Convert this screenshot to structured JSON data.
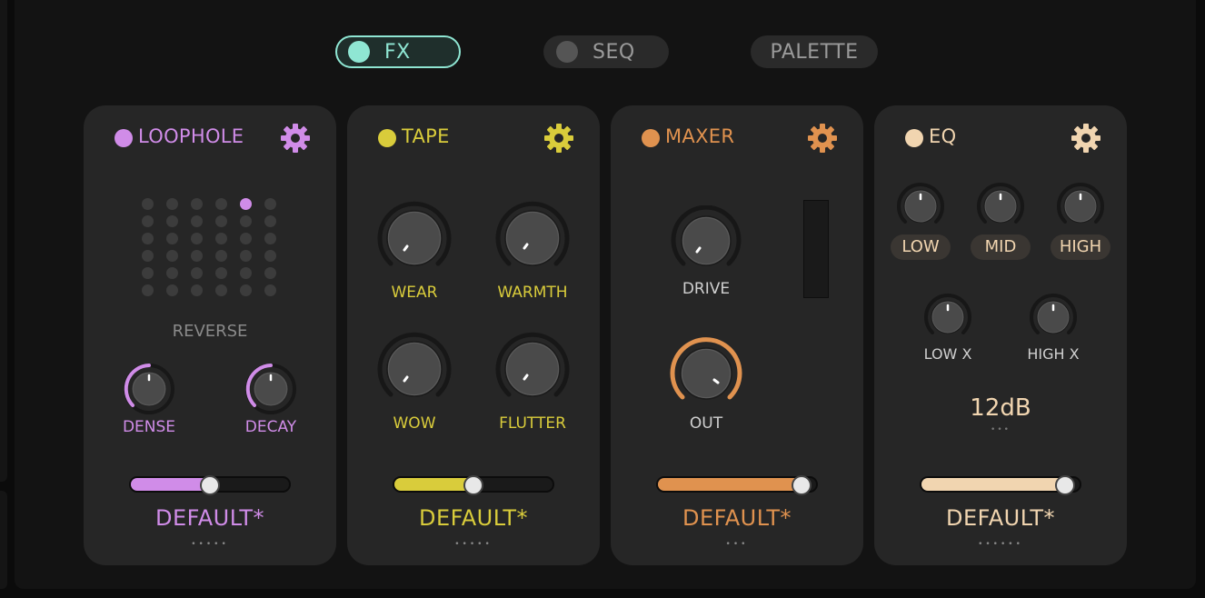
{
  "tabs": [
    {
      "label": "FX",
      "active": true
    },
    {
      "label": "SEQ",
      "active": false
    },
    {
      "label": "PALETTE",
      "active": false
    }
  ],
  "colors": {
    "teal": "#8fe6d3",
    "loophole": "#d08ce8",
    "tape": "#d9cc3b",
    "maxer": "#e0924f",
    "eq": "#f1d5b0"
  },
  "modules": {
    "loophole": {
      "name": "LOOPHOLE",
      "icon": "gear-icon",
      "grid_label": "REVERSE",
      "knobs": [
        {
          "label": "DENSE"
        },
        {
          "label": "DECAY"
        }
      ],
      "slider": {
        "value": 0.5
      },
      "preset": "DEFAULT*",
      "preset_dots": "•••••"
    },
    "tape": {
      "name": "TAPE",
      "icon": "gear-icon",
      "knobs": [
        {
          "label": "WEAR"
        },
        {
          "label": "WARMTH"
        },
        {
          "label": "WOW"
        },
        {
          "label": "FLUTTER"
        }
      ],
      "slider": {
        "value": 0.5
      },
      "preset": "DEFAULT*",
      "preset_dots": "•••••"
    },
    "maxer": {
      "name": "MAXER",
      "icon": "gear-icon",
      "knobs": [
        {
          "label": "DRIVE"
        },
        {
          "label": "OUT"
        }
      ],
      "slider": {
        "value": 0.95
      },
      "preset": "DEFAULT*",
      "preset_dots": "•••"
    },
    "eq": {
      "name": "EQ",
      "icon": "gear-icon",
      "bands": [
        {
          "label": "LOW"
        },
        {
          "label": "MID"
        },
        {
          "label": "HIGH"
        }
      ],
      "crossovers": [
        {
          "label": "LOW X"
        },
        {
          "label": "HIGH X"
        }
      ],
      "slope": "12dB",
      "slope_dots": "•••",
      "slider": {
        "value": 0.95
      },
      "preset": "DEFAULT*",
      "preset_dots": "••••••"
    }
  }
}
